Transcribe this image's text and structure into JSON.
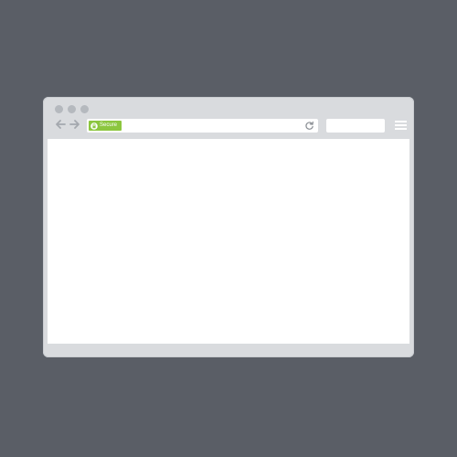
{
  "browser": {
    "address_bar": {
      "secure_label": "Secure",
      "secure_color": "#8cc63f",
      "url": ""
    },
    "icons": {
      "back": "arrow-left-icon",
      "forward": "arrow-right-icon",
      "lock": "lock-icon",
      "reload": "reload-icon",
      "menu": "hamburger-menu-icon"
    },
    "search_box": {
      "value": ""
    },
    "colors": {
      "background": "#5a5e66",
      "chrome": "#d9dbde",
      "content": "#ffffff",
      "traffic_dots": "#b5b9be"
    }
  }
}
